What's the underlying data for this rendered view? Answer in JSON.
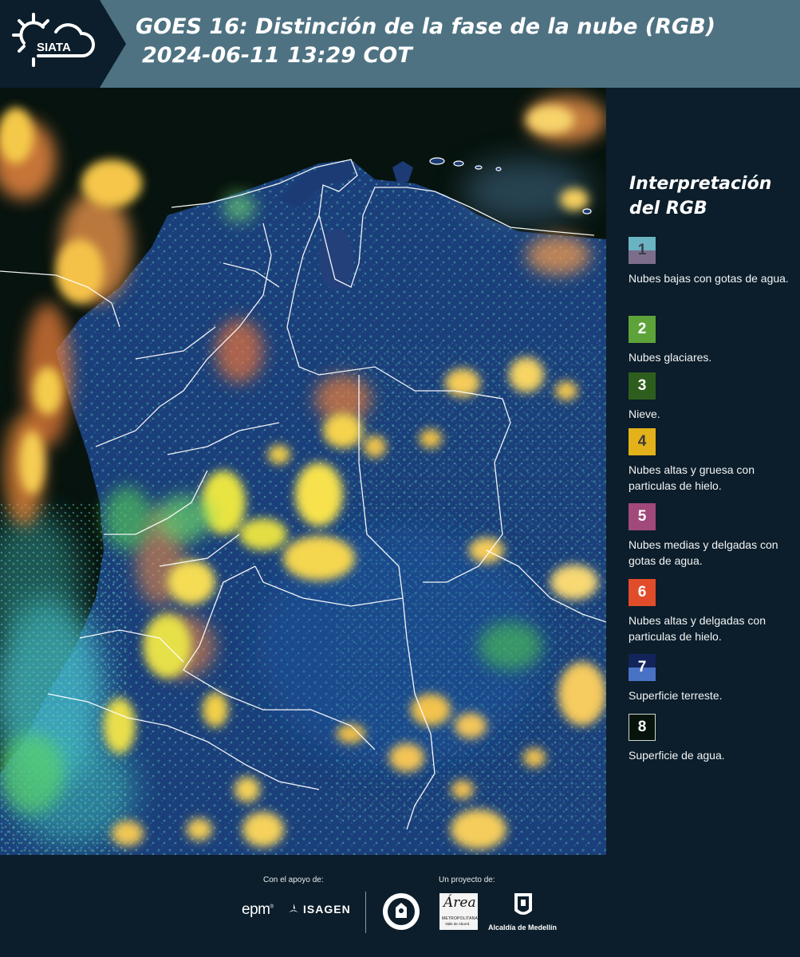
{
  "header": {
    "logo_text": "SIATA",
    "title_line1": "GOES 16: Distinción de la fase de la nube (RGB)",
    "title_line2": "2024-06-11 13:29 COT"
  },
  "map": {
    "image": "satellite-rgb-cloud-phase-colombia",
    "colors": {
      "ocean": "#07130e",
      "land": "#1b3f7a",
      "low_cloud": "#4fc8d4",
      "ice_cloud": "#f0c23a",
      "orange_cloud": "#ef7f3a",
      "green_cloud": "#5fd070",
      "border": "#ffffff"
    }
  },
  "legend": {
    "title": "Interpretación del RGB",
    "items": [
      {
        "number": "1",
        "description": "Nubes bajas con gotas de agua.",
        "colors": [
          "#6ab4c2",
          "#7c6e8b"
        ]
      },
      {
        "number": "2",
        "description": "Nubes glaciares.",
        "colors": [
          "#5ea33a"
        ]
      },
      {
        "number": "3",
        "description": "Nieve.",
        "colors": [
          "#2e5e1d"
        ]
      },
      {
        "number": "4",
        "description": "Nubes altas y gruesa con particulas de hielo.",
        "colors": [
          "#e3b21a"
        ]
      },
      {
        "number": "5",
        "description": "Nubes medias y delgadas con gotas de agua.",
        "colors": [
          "#a2497b"
        ]
      },
      {
        "number": "6",
        "description": "Nubes altas y delgadas con particulas de hielo.",
        "colors": [
          "#e14d2a"
        ]
      },
      {
        "number": "7",
        "description": "Superficie terreste.",
        "colors": [
          "#13245a",
          "#4872c4"
        ]
      },
      {
        "number": "8",
        "description": "Superficie de agua.",
        "colors": [
          "#06140c"
        ]
      }
    ]
  },
  "footer": {
    "support_label": "Con el apoyo de:",
    "project_label": "Un proyecto de:",
    "epm": "epm",
    "isagen": "ISAGEN",
    "area_letter": "Área",
    "area_metro": "METROPOLITANA",
    "area_valle": "Valle de Aburrá",
    "alcaldia": "Alcaldía de Medellín"
  }
}
